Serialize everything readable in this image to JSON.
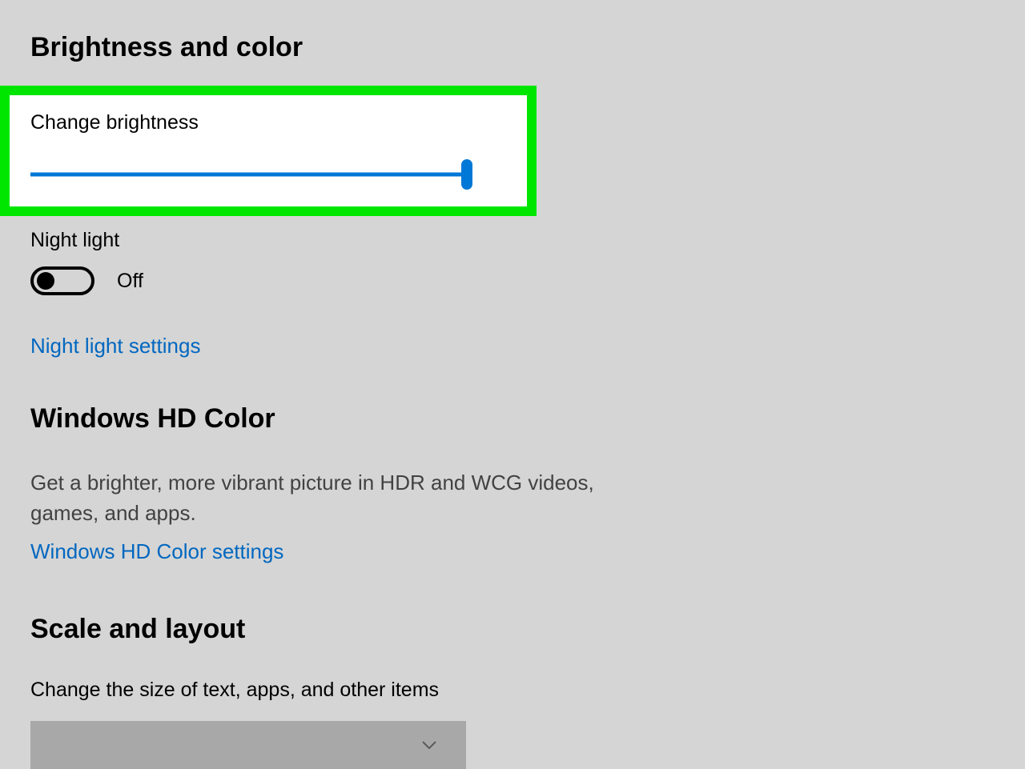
{
  "brightness_section": {
    "heading": "Brightness and color",
    "change_brightness_label": "Change brightness",
    "slider_value": 100
  },
  "night_light": {
    "label": "Night light",
    "state_text": "Off",
    "settings_link": "Night light settings"
  },
  "hd_color": {
    "heading": "Windows HD Color",
    "description": "Get a brighter, more vibrant picture in HDR and WCG videos, games, and apps.",
    "settings_link": "Windows HD Color settings"
  },
  "scale_layout": {
    "heading": "Scale and layout",
    "scale_label": "Change the size of text, apps, and other items"
  }
}
